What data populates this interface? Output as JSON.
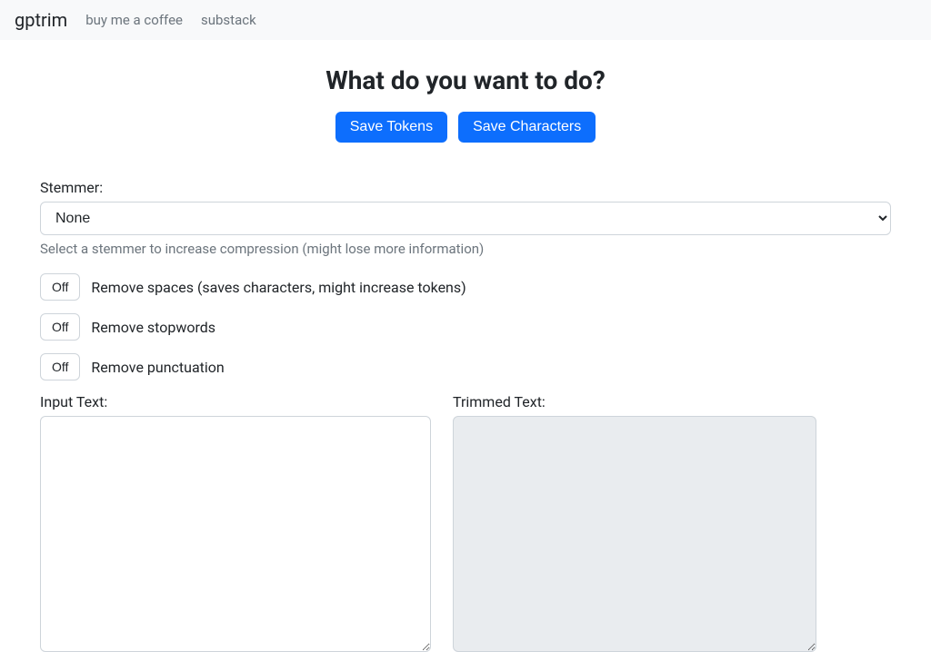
{
  "nav": {
    "brand": "gptrim",
    "links": [
      {
        "label": "buy me a coffee"
      },
      {
        "label": "substack"
      }
    ]
  },
  "heading": "What do you want to do?",
  "buttons": {
    "save_tokens": "Save Tokens",
    "save_characters": "Save Characters"
  },
  "stemmer": {
    "label": "Stemmer:",
    "selected": "None",
    "help": "Select a stemmer to increase compression (might lose more information)"
  },
  "toggles": {
    "off_label": "Off",
    "remove_spaces": "Remove spaces (saves characters, might increase tokens)",
    "remove_stopwords": "Remove stopwords",
    "remove_punctuation": "Remove punctuation"
  },
  "text_panes": {
    "input_label": "Input Text:",
    "output_label": "Trimmed Text:",
    "input_value": "",
    "output_value": ""
  }
}
